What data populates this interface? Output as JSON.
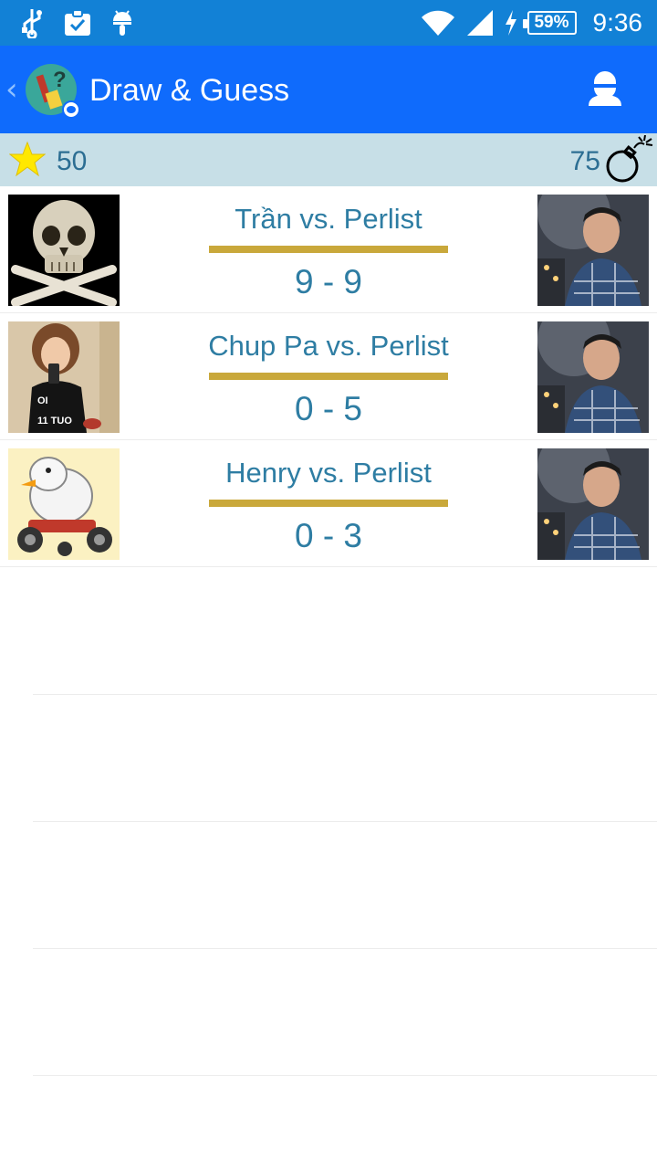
{
  "status_bar": {
    "battery": "59%",
    "time": "9:36"
  },
  "app_bar": {
    "title": "Draw & Guess"
  },
  "score_bar": {
    "stars": "50",
    "bombs": "75"
  },
  "matches": [
    {
      "title": "Trần vs. Perlist",
      "score": "9 - 9"
    },
    {
      "title": "Chup Pa vs. Perlist",
      "score": "0 - 5"
    },
    {
      "title": "Henry vs. Perlist",
      "score": "0 - 3"
    }
  ],
  "colors": {
    "status_bar": "#1281d6",
    "app_bar": "#0f6bfc",
    "score_bar": "#c7dfe7",
    "text_blue": "#2e7da3",
    "divider_gold": "#c9a83b"
  }
}
